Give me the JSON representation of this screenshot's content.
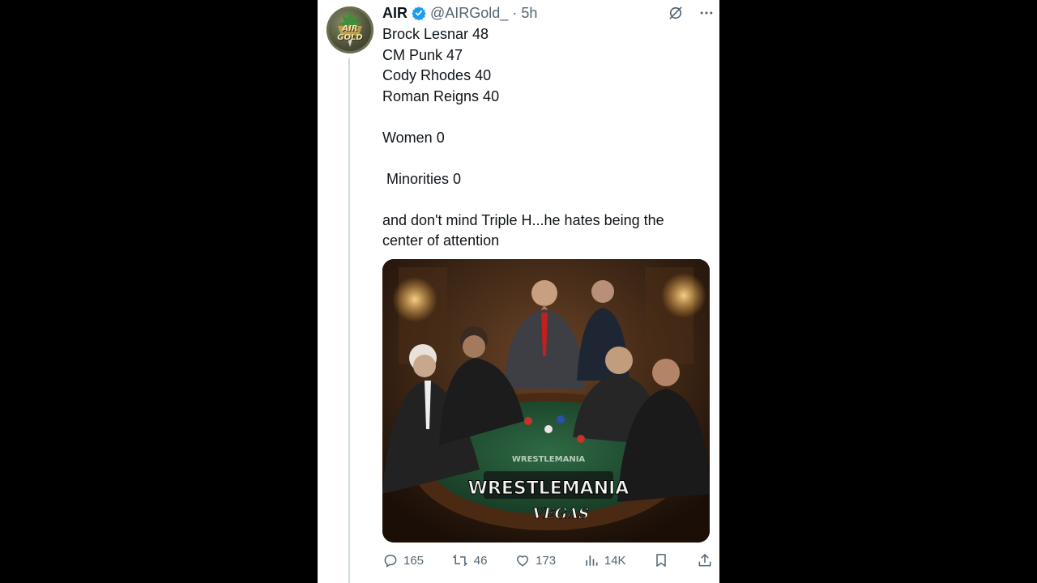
{
  "post": {
    "author_name": "AIR",
    "handle": "@AIRGold_",
    "separator": "·",
    "time": "5h",
    "avatar_text": "AIR GOLD",
    "lines": [
      "Brock Lesnar 48",
      "CM Punk 47",
      "Cody Rhodes 40",
      "Roman Reigns 40",
      "",
      "Women 0",
      "",
      " Minorities 0",
      "",
      "and don't mind Triple H...he hates being the center of attention"
    ],
    "image": {
      "logo_main": "WRESTLEMANIA",
      "logo_sub": "VEGAS",
      "table_text": "WRESTLEMANIA"
    },
    "actions": {
      "replies": "165",
      "reposts": "46",
      "likes": "173",
      "views": "14K"
    }
  },
  "colors": {
    "verified": "#1d9bf0",
    "text": "#0f1419",
    "muted": "#536471"
  },
  "icons": [
    "verified-badge-icon",
    "grok-icon",
    "more-icon",
    "reply-icon",
    "repost-icon",
    "like-icon",
    "views-icon",
    "bookmark-icon",
    "share-icon"
  ]
}
